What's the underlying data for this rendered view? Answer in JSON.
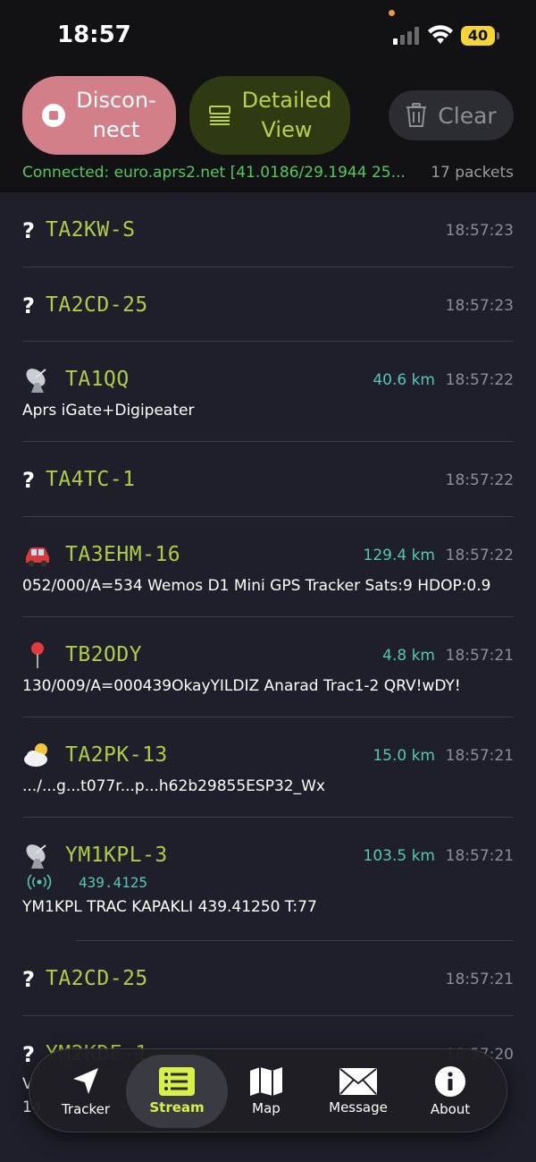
{
  "status": {
    "time": "18:57",
    "battery": "40"
  },
  "toolbar": {
    "disconnect_label": "Discon-\nnect",
    "detailed_label": "Detailed\nView",
    "clear_label": "Clear"
  },
  "connection": {
    "text": "Connected: euro.aprs2.net [41.0186/29.1944 25...",
    "packets": "17 packets"
  },
  "packets": [
    {
      "callsign": "TA2KW-S",
      "time": "18:57:23"
    },
    {
      "callsign": "TA2CD-25",
      "time": "18:57:23"
    },
    {
      "callsign": "TA1QQ",
      "distance": "40.6 km",
      "time": "18:57:22",
      "comment": "Aprs iGate+Digipeater"
    },
    {
      "callsign": "TA4TC-1",
      "time": "18:57:22"
    },
    {
      "callsign": "TA3EHM-16",
      "distance": "129.4 km",
      "time": "18:57:22",
      "comment": "052/000/A=534 Wemos D1 Mini GPS Tracker Sats:9 HDOP:0.9"
    },
    {
      "callsign": "TB2ODY",
      "distance": "4.8 km",
      "time": "18:57:21",
      "comment": "130/009/A=000439OkayYILDIZ Anarad Trac1-2 QRV!wDY!"
    },
    {
      "callsign": "TA2PK-13",
      "distance": "15.0 km",
      "time": "18:57:21",
      "comment": ".../...g...t077r...p...h62b29855ESP32_Wx"
    },
    {
      "callsign": "YM1KPL-3",
      "distance": "103.5 km",
      "time": "18:57:21",
      "frequency": "439.4125",
      "comment": "YM1KPL TRAC KAPAKLI 439.41250 T:77"
    },
    {
      "callsign": "TA2CD-25",
      "time": "18:57:21"
    },
    {
      "callsign": "YM2KDE-1",
      "time": "18:57:20",
      "comment": "V",
      "comment2": "14"
    }
  ],
  "nav": {
    "tracker": "Tracker",
    "stream": "Stream",
    "map": "Map",
    "message": "Message",
    "about": "About"
  },
  "colors": {
    "callsign": "#b0cc46",
    "distance": "#56c6b2",
    "connected": "#57c75f",
    "accent": "#d8f04a"
  }
}
